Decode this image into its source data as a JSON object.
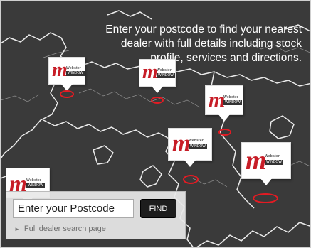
{
  "headline": "Enter your postcode to find your nearest dealer with full details including stock profile, services and directions.",
  "colors": {
    "map_background": "#3a3a3a",
    "coastline": "#ffffff",
    "accent_red": "#e41b23"
  },
  "dealer_logo": {
    "mark": "m",
    "brand_text": "Webster",
    "window_text": "WINDOW"
  },
  "search": {
    "postcode_placeholder": "Enter your Postcode",
    "postcode_value": "",
    "find_label": "FIND",
    "full_search_link": "Full dealer search page",
    "link_icon": "right-triangle-icon"
  }
}
